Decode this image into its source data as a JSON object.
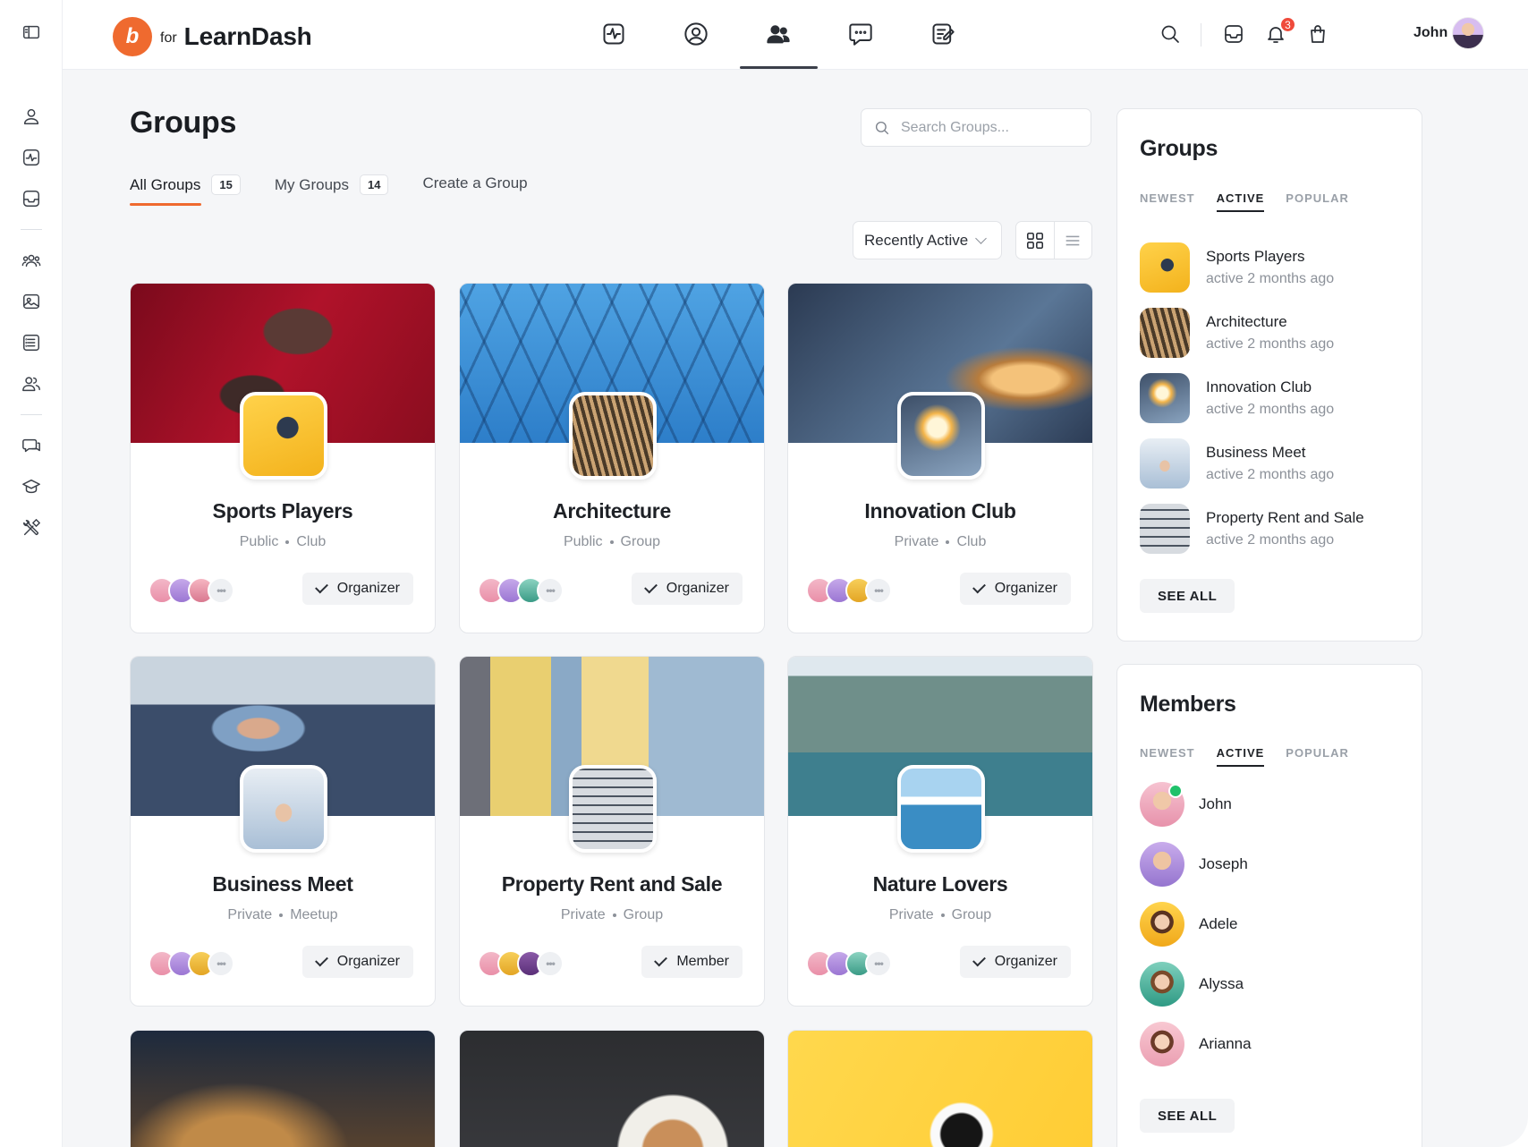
{
  "app": {
    "logo_letter": "b",
    "logo_for": "for",
    "logo_name": "LearnDash",
    "user_name": "John",
    "notification_count": "3",
    "brand_color": "#ef6a2f"
  },
  "sidebar": {
    "icons": [
      "panel-toggle-icon",
      "profile-icon",
      "activity-icon",
      "inbox-icon",
      "groups-icon",
      "photos-icon",
      "forums-list-icon",
      "members-icon",
      "messages-icon",
      "courses-icon",
      "tools-icon"
    ]
  },
  "topnav": {
    "items": [
      "activity-icon",
      "profile-icon",
      "groups-icon",
      "messages-icon",
      "forums-icon"
    ],
    "active": "groups-icon"
  },
  "page": {
    "title": "Groups",
    "search_placeholder": "Search Groups...",
    "tabs": [
      {
        "label": "All Groups",
        "count": "15"
      },
      {
        "label": "My Groups",
        "count": "14"
      },
      {
        "label": "Create a Group",
        "count": ""
      }
    ],
    "sort_label": "Recently Active"
  },
  "groups": [
    {
      "title": "Sports Players",
      "privacy": "Public",
      "type": "Club",
      "role": "Organizer"
    },
    {
      "title": "Architecture",
      "privacy": "Public",
      "type": "Group",
      "role": "Organizer"
    },
    {
      "title": "Innovation Club",
      "privacy": "Private",
      "type": "Club",
      "role": "Organizer"
    },
    {
      "title": "Business Meet",
      "privacy": "Private",
      "type": "Meetup",
      "role": "Organizer"
    },
    {
      "title": "Property Rent and Sale",
      "privacy": "Private",
      "type": "Group",
      "role": "Member"
    },
    {
      "title": "Nature Lovers",
      "privacy": "Private",
      "type": "Group",
      "role": "Organizer"
    }
  ],
  "groups_widget": {
    "title": "Groups",
    "tabs": [
      "NEWEST",
      "ACTIVE",
      "POPULAR"
    ],
    "active_tab": "ACTIVE",
    "items": [
      {
        "name": "Sports Players",
        "activity": "active 2 months ago"
      },
      {
        "name": "Architecture",
        "activity": "active 2 months ago"
      },
      {
        "name": "Innovation Club",
        "activity": "active 2 months ago"
      },
      {
        "name": "Business Meet",
        "activity": "active 2 months ago"
      },
      {
        "name": "Property Rent and Sale",
        "activity": "active 2 months ago"
      }
    ],
    "see_all": "SEE ALL"
  },
  "members_widget": {
    "title": "Members",
    "tabs": [
      "NEWEST",
      "ACTIVE",
      "POPULAR"
    ],
    "active_tab": "ACTIVE",
    "items": [
      {
        "name": "John",
        "online": true
      },
      {
        "name": "Joseph",
        "online": false
      },
      {
        "name": "Adele",
        "online": false
      },
      {
        "name": "Alyssa",
        "online": false
      },
      {
        "name": "Arianna",
        "online": false
      }
    ],
    "see_all": "SEE ALL"
  }
}
